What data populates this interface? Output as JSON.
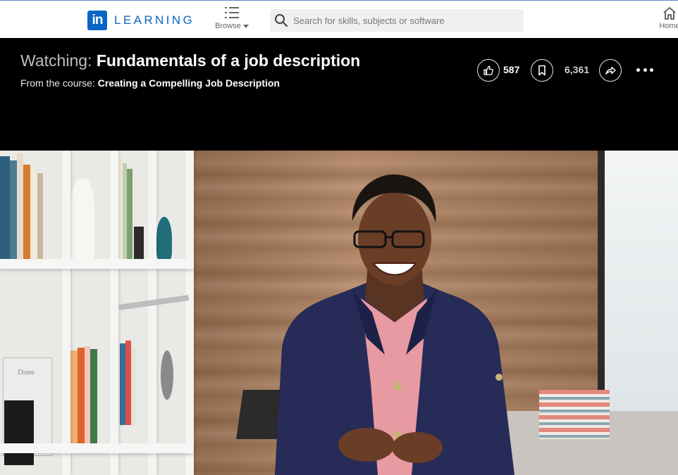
{
  "nav": {
    "brand_label": "LEARNING",
    "logo_text": "in",
    "browse_label": "Browse",
    "search_placeholder": "Search for skills, subjects or software",
    "home_label": "Home",
    "colors": {
      "brand": "#0a66c2"
    },
    "icons": {
      "browse": "list-icon",
      "search": "search-icon",
      "home": "home-icon"
    }
  },
  "header": {
    "watching_prefix": "Watching:",
    "video_title": "Fundamentals of a job description",
    "course_prefix": "From the course:",
    "course_title": "Creating a Compelling Job Description",
    "like_count": "587",
    "save_count": "6,361",
    "icons": {
      "like": "thumbs-up-icon",
      "save": "bookmark-icon",
      "share": "share-icon",
      "more": "more-options-icon"
    }
  },
  "video": {
    "shelf_book_text": "Done"
  }
}
